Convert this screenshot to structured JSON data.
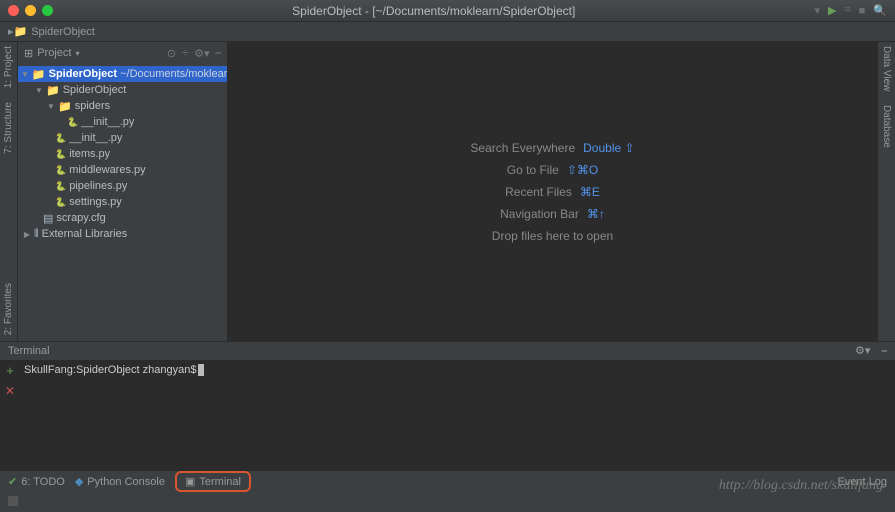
{
  "title": "SpiderObject - [~/Documents/moklearn/SpiderObject]",
  "breadcrumb": "SpiderObject",
  "project_header": "Project",
  "tree": {
    "root_name": "SpiderObject",
    "root_path": "~/Documents/moklearn/SpiderObject",
    "pkg": "SpiderObject",
    "spiders": "spiders",
    "files": [
      "__init__.py",
      "__init__.py",
      "items.py",
      "middlewares.py",
      "pipelines.py",
      "settings.py"
    ],
    "cfg": "scrapy.cfg",
    "ext": "External Libraries"
  },
  "hints": [
    {
      "label": "Search Everywhere",
      "shortcut": "Double ⇧"
    },
    {
      "label": "Go to File",
      "shortcut": "⇧⌘O"
    },
    {
      "label": "Recent Files",
      "shortcut": "⌘E"
    },
    {
      "label": "Navigation Bar",
      "shortcut": "⌘↑"
    },
    {
      "label": "Drop files here to open",
      "shortcut": ""
    }
  ],
  "side_left": [
    "1: Project",
    "7: Structure"
  ],
  "side_right": [
    "Data View",
    "Database"
  ],
  "side_bottom_left": "2: Favorites",
  "terminal": {
    "title": "Terminal",
    "prompt": "SkullFang:SpiderObject zhangyan$"
  },
  "status": {
    "todo": "6: TODO",
    "pyconsole": "Python Console",
    "terminal": "Terminal",
    "eventlog": "Event Log"
  },
  "watermark": "http://blog.csdn.net/skullfang"
}
